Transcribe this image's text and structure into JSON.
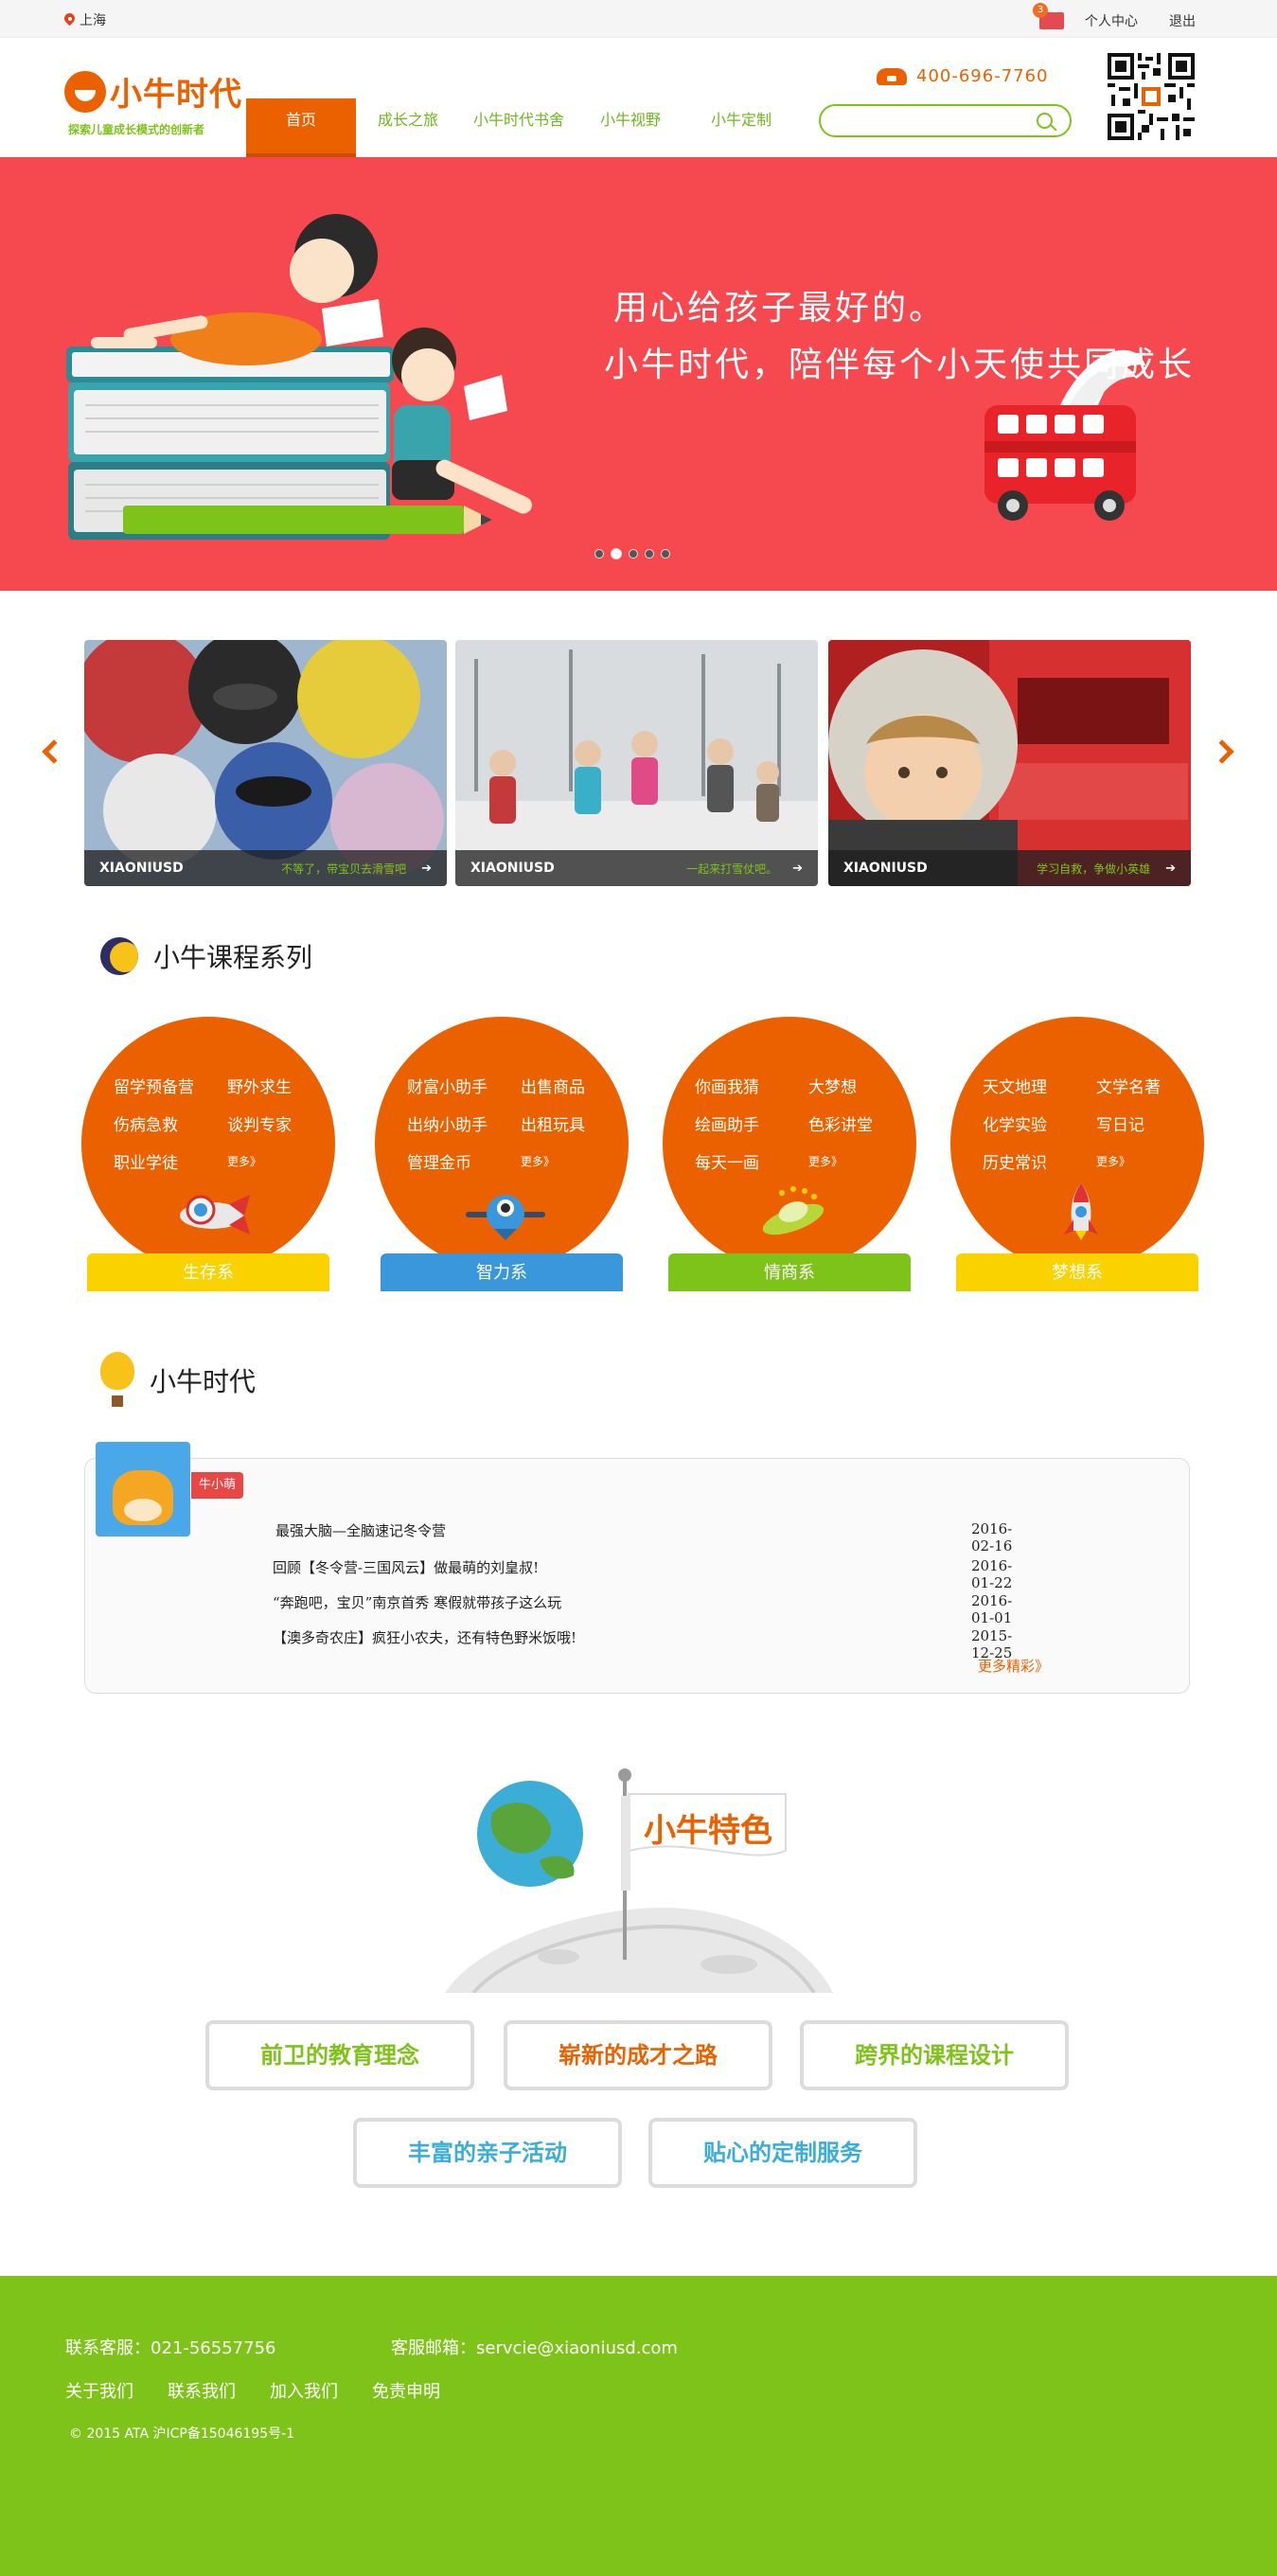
{
  "topbar": {
    "location": "上海",
    "mail_count": "3",
    "user_center": "个人中心",
    "logout": "退出"
  },
  "header": {
    "logo_text": "小牛时代",
    "slogan": "探索儿童成长模式的创新者",
    "nav": [
      "首页",
      "成长之旅",
      "小牛时代书舍",
      "小牛视野",
      "小牛定制"
    ],
    "phone": "400-696-7760",
    "search_placeholder": ""
  },
  "banner": {
    "line1": "用心给孩子最好的。",
    "line2": "小牛时代，陪伴每个小天使共同成长",
    "dots": 5,
    "active_dot": 2
  },
  "carousel": [
    {
      "brand": "XIAONIUSD",
      "text": "不等了，带宝贝去滑雪吧",
      "go": "➔"
    },
    {
      "brand": "XIAONIUSD",
      "text": "一起来打雪仗吧。",
      "go": "➔"
    },
    {
      "brand": "XIAONIUSD",
      "text": "学习自救，争做小英雄",
      "go": "➔"
    }
  ],
  "courses": {
    "title": "小牛课程系列",
    "series": [
      {
        "name": "生存系",
        "items": [
          "留学预备营",
          "野外求生",
          "伤病急救",
          "谈判专家",
          "职业学徒",
          "更多》"
        ],
        "tab_color": "#f9d200",
        "tab_text": "#ffffff"
      },
      {
        "name": "智力系",
        "items": [
          "财富小助手",
          "出售商品",
          "出纳小助手",
          "出租玩具",
          "管理金币",
          "更多》"
        ],
        "tab_color": "#3b97db",
        "tab_text": "#ffffff"
      },
      {
        "name": "情商系",
        "items": [
          "你画我猜",
          "大梦想",
          "绘画助手",
          "色彩讲堂",
          "每天一画",
          "更多》"
        ],
        "tab_color": "#7ec31a",
        "tab_text": "#ffffff"
      },
      {
        "name": "梦想系",
        "items": [
          "天文地理",
          "文学名著",
          "化学实验",
          "写日记",
          "历史常识",
          "更多》"
        ],
        "tab_color": "#f9d200",
        "tab_text": "#ffffff"
      }
    ]
  },
  "news": {
    "title": "小牛时代",
    "author": "牛小萌",
    "items": [
      {
        "title": "最强大脑—全脑速记冬令营",
        "date": "2016-02-16"
      },
      {
        "title": "回顾【冬令营-三国风云】做最萌的刘皇叔!",
        "date": "2016-01-22"
      },
      {
        "title": "“奔跑吧，宝贝”南京首秀 寒假就带孩子这么玩",
        "date": "2016-01-01"
      },
      {
        "title": "【澳多奇农庄】疯狂小农夫，还有特色野米饭哦!",
        "date": "2015-12-25"
      }
    ],
    "more": "更多精彩》"
  },
  "features": {
    "title": "小牛特色",
    "buttons": [
      {
        "label": "前卫的教育理念",
        "color": "#7ec31a"
      },
      {
        "label": "崭新的成才之路",
        "color": "#eb6100"
      },
      {
        "label": "跨界的课程设计",
        "color": "#7ec31a"
      },
      {
        "label": "丰富的亲子活动",
        "color": "#3badd6"
      },
      {
        "label": "贴心的定制服务",
        "color": "#3badd6"
      }
    ]
  },
  "footer": {
    "phone": "联系客服：021-56557756",
    "email": "客服邮箱：servcie@xiaoniusd.com",
    "links": [
      "关于我们",
      "联系我们",
      "加入我们",
      "免责申明"
    ],
    "copyright": "© 2015 ATA 沪ICP备15046195号-1"
  },
  "colors": {
    "brand_orange": "#eb6100",
    "brand_green": "#7ec31a",
    "banner_red": "#f5484f"
  }
}
